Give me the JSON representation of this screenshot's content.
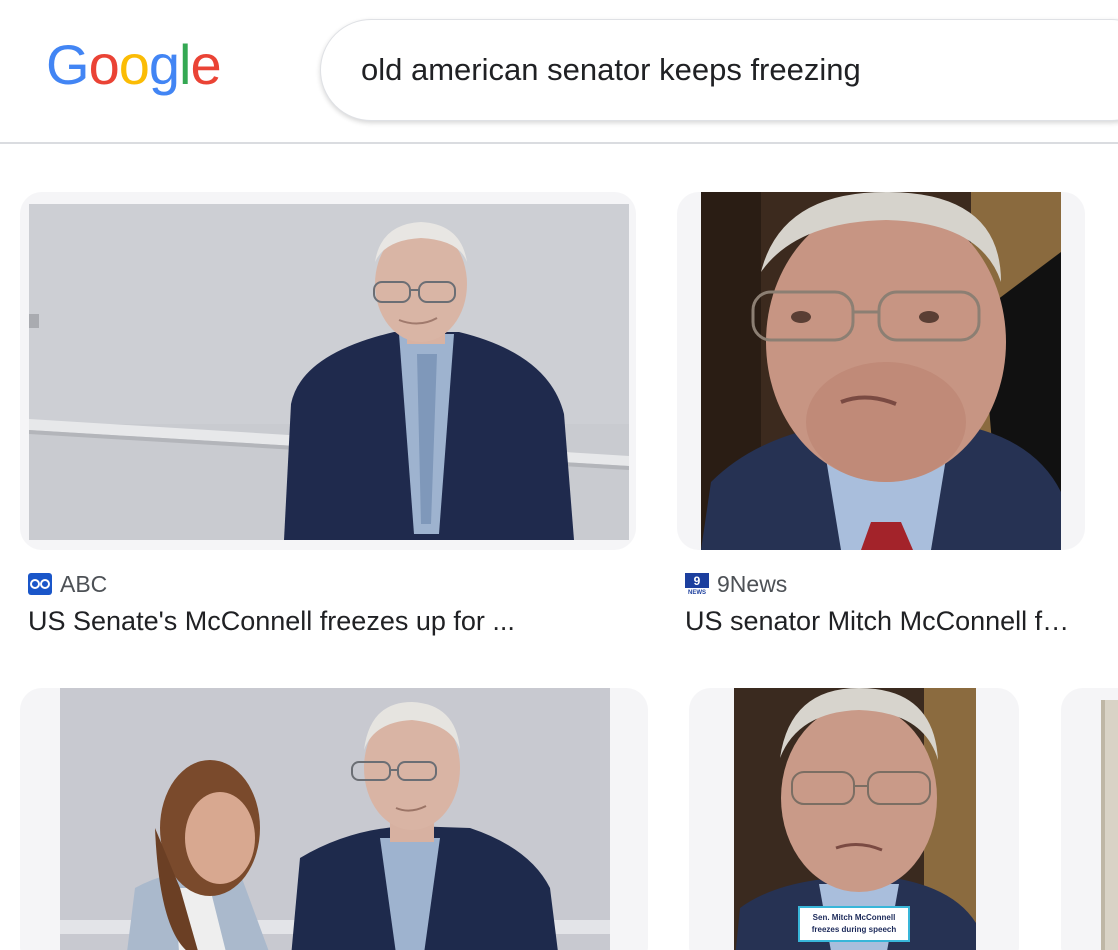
{
  "header": {
    "logo": {
      "letters": [
        "G",
        "o",
        "o",
        "g",
        "l",
        "e"
      ],
      "colors": [
        "#4285F4",
        "#EA4335",
        "#FBBC05",
        "#4285F4",
        "#34A853",
        "#EA4335"
      ]
    },
    "search": {
      "value": "old american senator keeps freezing"
    }
  },
  "results": [
    {
      "source": "ABC",
      "source_icon": "abc-logo-icon",
      "title": "US Senate's McConnell freezes up for ..."
    },
    {
      "source": "9News",
      "source_icon": "9news-logo-icon",
      "title": "US senator Mitch McConnell freezes ..."
    },
    {
      "source": "",
      "title": ""
    },
    {
      "source": "",
      "title": "",
      "overlay_caption": "Sen. Mitch McConnell freezes during speech"
    }
  ],
  "colors": {
    "accent_blue": "#1a73e8",
    "text_primary": "#202124",
    "text_secondary": "#4d5156",
    "card_bg": "#f5f5f7"
  }
}
